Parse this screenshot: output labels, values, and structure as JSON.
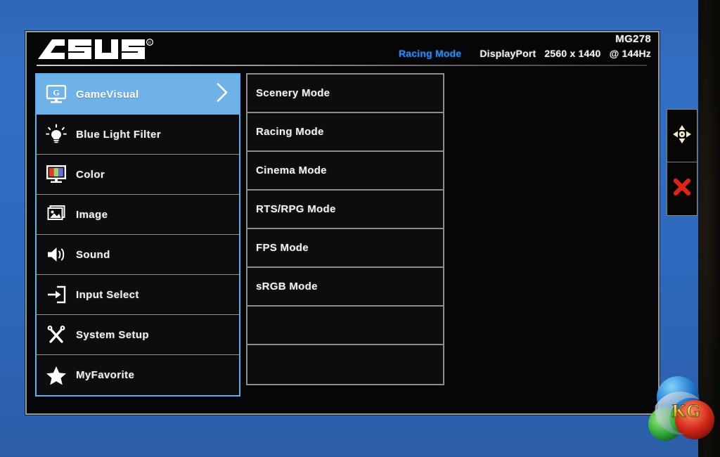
{
  "header": {
    "brand_logo": "asus-logo",
    "model": "MG278",
    "mode": "Racing Mode",
    "source": "DisplayPort",
    "resolution": "2560 x 1440",
    "refresh": "@ 144Hz"
  },
  "sidebar": {
    "items": [
      {
        "label": "GameVisual",
        "icon": "gamevisual-monitor-icon",
        "active": true,
        "has_chevron": true
      },
      {
        "label": "Blue Light Filter",
        "icon": "lightbulb-icon",
        "active": false,
        "has_chevron": false
      },
      {
        "label": "Color",
        "icon": "color-bars-monitor-icon",
        "active": false,
        "has_chevron": false
      },
      {
        "label": "Image",
        "icon": "picture-stack-icon",
        "active": false,
        "has_chevron": false
      },
      {
        "label": "Sound",
        "icon": "speaker-icon",
        "active": false,
        "has_chevron": false
      },
      {
        "label": "Input Select",
        "icon": "input-arrow-icon",
        "active": false,
        "has_chevron": false
      },
      {
        "label": "System Setup",
        "icon": "wrench-screwdriver-icon",
        "active": false,
        "has_chevron": false
      },
      {
        "label": "MyFavorite",
        "icon": "star-icon",
        "active": false,
        "has_chevron": false
      }
    ]
  },
  "submenu": {
    "items": [
      {
        "label": "Scenery Mode"
      },
      {
        "label": "Racing Mode"
      },
      {
        "label": "Cinema Mode"
      },
      {
        "label": "RTS/RPG Mode"
      },
      {
        "label": "FPS Mode"
      },
      {
        "label": "sRGB Mode"
      },
      {
        "label": ""
      },
      {
        "label": ""
      }
    ]
  },
  "hardware_buttons": [
    {
      "name": "navigation-dpad",
      "icon": "four-way-arrow-icon"
    },
    {
      "name": "close-osd",
      "icon": "close-x-icon"
    }
  ],
  "watermark": {
    "text": "KG",
    "name": "kitguru-logo"
  },
  "colors": {
    "highlight": "#6fb2e8",
    "accent_blue": "#2f86e8",
    "sidebar_border": "#57b0ef",
    "submenu_border": "#8d8d86",
    "close_red": "#e02318",
    "wallpaper_blue": "#2f6fc4"
  }
}
